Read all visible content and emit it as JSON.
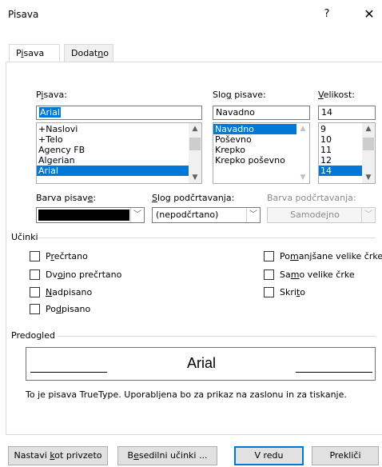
{
  "window": {
    "title": "Pisava",
    "help_label": "?",
    "close_label": "✕"
  },
  "tabs": [
    {
      "label_pre": "P",
      "label_ul": "i",
      "label_post": "sava",
      "active": true
    },
    {
      "label_pre": "Dodat",
      "label_ul": "n",
      "label_post": "o",
      "active": false
    }
  ],
  "font": {
    "label_pre": "P",
    "label_ul": "i",
    "label_post": "sava:",
    "value": "Arial",
    "items": [
      "+Naslovi",
      "+Telo",
      "Agency FB",
      "Algerian",
      "Arial"
    ],
    "selected_index": 4
  },
  "style": {
    "label_pre": "Slo",
    "label_ul": "g",
    "label_post": " pisave:",
    "value": "Navadno",
    "items": [
      "Navadno",
      "Poševno",
      "Krepko",
      "Krepko poševno"
    ],
    "selected_index": 0
  },
  "size": {
    "label_pre": "",
    "label_ul": "V",
    "label_post": "elikost:",
    "value": "14",
    "items": [
      "9",
      "10",
      "11",
      "12",
      "14"
    ],
    "selected_index": 4
  },
  "font_color": {
    "label_pre": "Barva pisav",
    "label_ul": "e",
    "label_post": ":",
    "value_color": "#000000"
  },
  "underline_style": {
    "label_pre": "",
    "label_ul": "S",
    "label_post": "log podčrtavanja:",
    "value": "(nepodčrtano)"
  },
  "underline_color": {
    "label": "Barva podčrtavanja:",
    "value": "Samodejno"
  },
  "effects": {
    "title": "Učinki",
    "left": [
      {
        "pre": "P",
        "ul": "r",
        "post": "ečrtano",
        "checked": false
      },
      {
        "pre": "Dv",
        "ul": "o",
        "post": "jno prečrtano",
        "checked": false
      },
      {
        "pre": "",
        "ul": "N",
        "post": "adpisano",
        "checked": false
      },
      {
        "pre": "Po",
        "ul": "d",
        "post": "pisano",
        "checked": false
      }
    ],
    "right": [
      {
        "pre": "Po",
        "ul": "m",
        "post": "anjšane velike črke",
        "checked": false
      },
      {
        "pre": "Sa",
        "ul": "m",
        "post": "o velike črke",
        "checked": false
      },
      {
        "pre": "Skri",
        "ul": "t",
        "post": "o",
        "checked": false
      }
    ]
  },
  "preview": {
    "title": "Predogled",
    "sample": "Arial",
    "note": "To je pisava TrueType. Uporabljena bo za prikaz na zaslonu in za tiskanje."
  },
  "buttons": {
    "set_default_pre": "Nastavi ",
    "set_default_ul": "k",
    "set_default_post": "ot privzeto",
    "text_effects_pre": "B",
    "text_effects_ul": "e",
    "text_effects_post": "sedilni učinki ...",
    "ok": "V redu",
    "cancel": "Prekliči"
  },
  "colors": {
    "selection": "#0078d7",
    "primary_border": "#0078d7"
  }
}
